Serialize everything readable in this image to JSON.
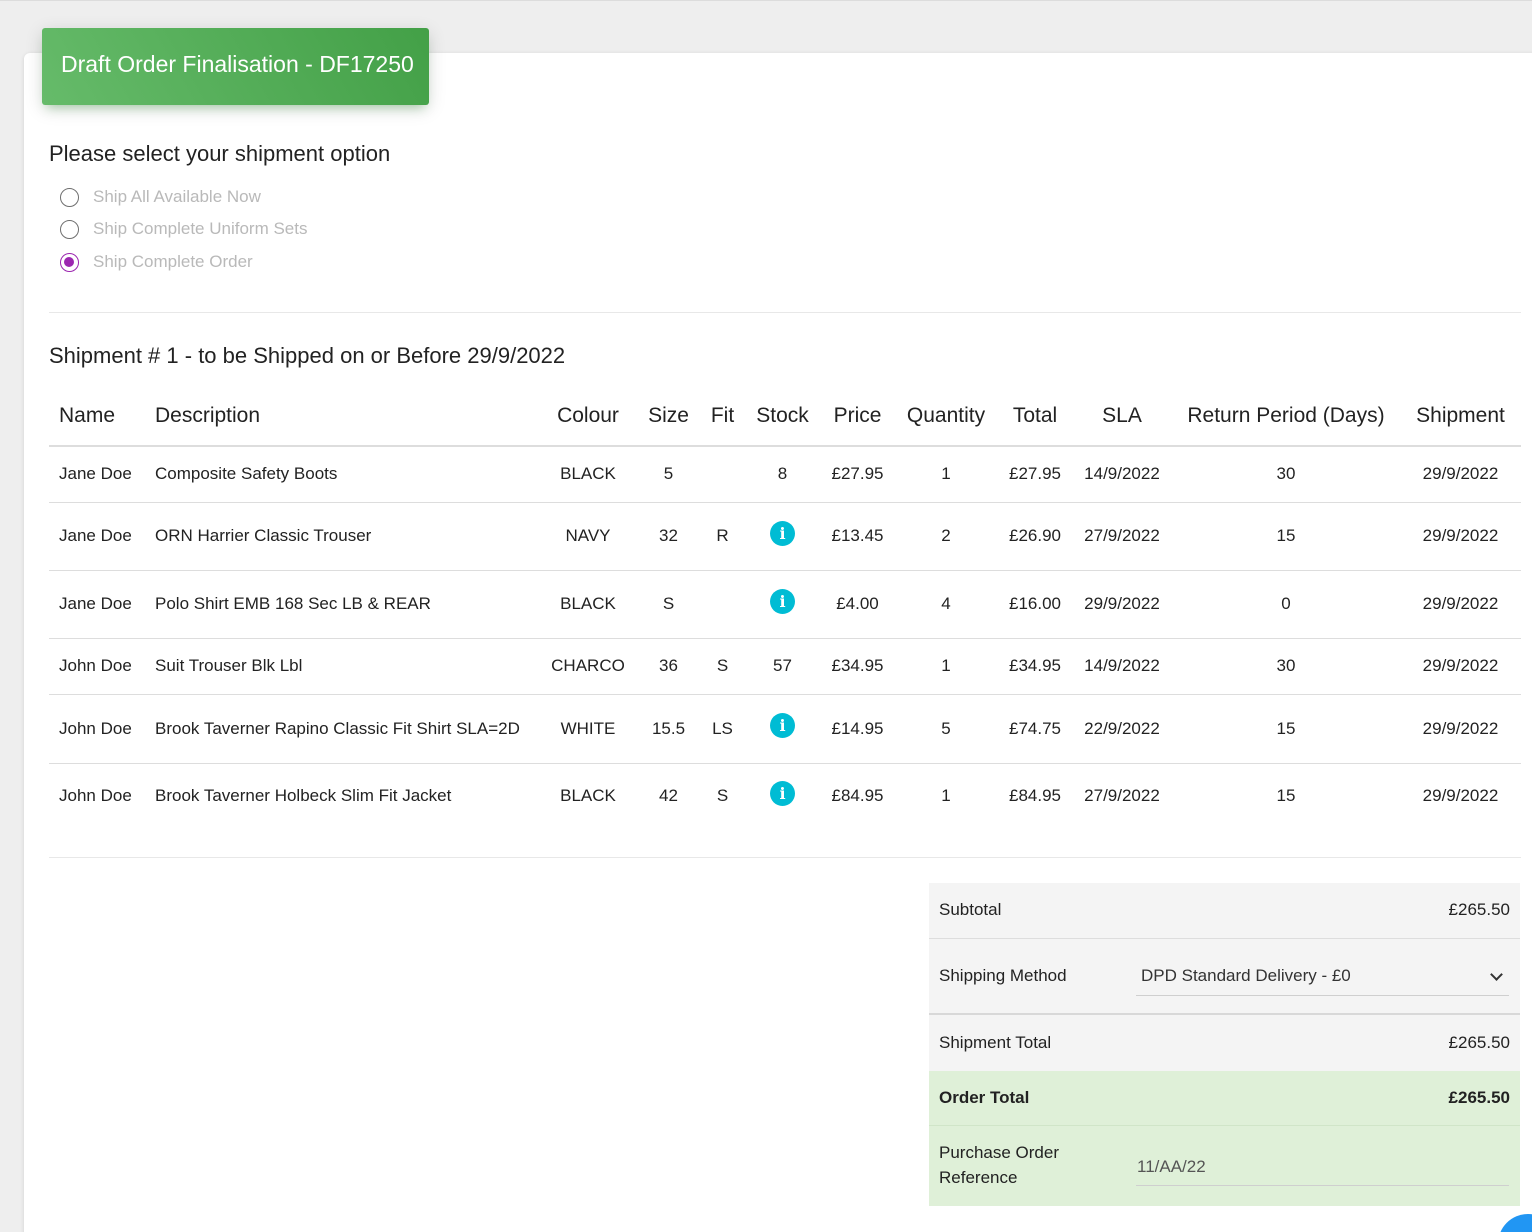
{
  "header": {
    "title": "Draft Order Finalisation - DF17250"
  },
  "shipment_options": {
    "title": "Please select your shipment option",
    "options": [
      {
        "label": "Ship All Available Now",
        "selected": false
      },
      {
        "label": "Ship Complete Uniform Sets",
        "selected": false
      },
      {
        "label": "Ship Complete Order",
        "selected": true
      }
    ]
  },
  "shipment": {
    "title": "Shipment # 1 - to be Shipped on or Before 29/9/2022",
    "columns": [
      "Name",
      "Description",
      "Colour",
      "Size",
      "Fit",
      "Stock",
      "Price",
      "Quantity",
      "Total",
      "SLA",
      "Return Period (Days)",
      "Shipment"
    ],
    "rows": [
      {
        "name": "Jane Doe",
        "description": "Composite Safety Boots",
        "colour": "BLACK",
        "size": "5",
        "fit": "",
        "stock": "8",
        "stock_icon": "",
        "price": "£27.95",
        "quantity": "1",
        "total": "£27.95",
        "sla": "14/9/2022",
        "return_period": "30",
        "shipment": "29/9/2022"
      },
      {
        "name": "Jane Doe",
        "description": "ORN Harrier Classic Trouser",
        "colour": "NAVY",
        "size": "32",
        "fit": "R",
        "stock": "",
        "stock_icon": "info-icon",
        "price": "£13.45",
        "quantity": "2",
        "total": "£26.90",
        "sla": "27/9/2022",
        "return_period": "15",
        "shipment": "29/9/2022"
      },
      {
        "name": "Jane Doe",
        "description": "Polo Shirt EMB 168 Sec LB & REAR",
        "colour": "BLACK",
        "size": "S",
        "fit": "",
        "stock": "",
        "stock_icon": "info-icon",
        "price": "£4.00",
        "quantity": "4",
        "total": "£16.00",
        "sla": "29/9/2022",
        "return_period": "0",
        "shipment": "29/9/2022"
      },
      {
        "name": "John Doe",
        "description": "Suit Trouser Blk Lbl",
        "colour": "CHARCO",
        "size": "36",
        "fit": "S",
        "stock": "57",
        "stock_icon": "",
        "price": "£34.95",
        "quantity": "1",
        "total": "£34.95",
        "sla": "14/9/2022",
        "return_period": "30",
        "shipment": "29/9/2022"
      },
      {
        "name": "John Doe",
        "description": "Brook Taverner Rapino Classic Fit Shirt SLA=2D",
        "colour": "WHITE",
        "size": "15.5",
        "fit": "LS",
        "stock": "",
        "stock_icon": "info-icon",
        "price": "£14.95",
        "quantity": "5",
        "total": "£74.75",
        "sla": "22/9/2022",
        "return_period": "15",
        "shipment": "29/9/2022"
      },
      {
        "name": "John Doe",
        "description": "Brook Taverner Holbeck Slim Fit Jacket",
        "colour": "BLACK",
        "size": "42",
        "fit": "S",
        "stock": "",
        "stock_icon": "info-icon",
        "price": "£84.95",
        "quantity": "1",
        "total": "£84.95",
        "sla": "27/9/2022",
        "return_period": "15",
        "shipment": "29/9/2022"
      }
    ]
  },
  "summary": {
    "subtotal_label": "Subtotal",
    "subtotal_value": "£265.50",
    "shipping_method_label": "Shipping Method",
    "shipping_method_value": "DPD Standard Delivery - £0",
    "shipment_total_label": "Shipment Total",
    "shipment_total_value": "£265.50",
    "order_total_label": "Order Total",
    "order_total_value": "£265.50",
    "po_reference_label": "Purchase Order Reference",
    "po_reference_value": "11/AA/22"
  },
  "colors": {
    "header_green": "#4caf50",
    "radio_purple": "#9c27b0",
    "info_cyan": "#00bcd4",
    "total_row_green": "#dff0d8",
    "fab_blue": "#2196f3"
  }
}
